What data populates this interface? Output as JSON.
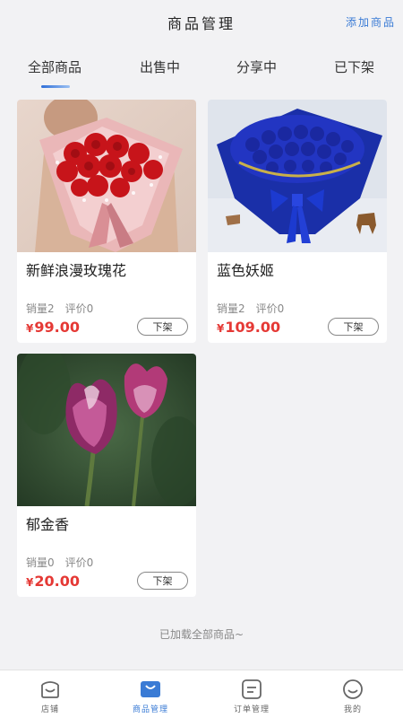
{
  "header": {
    "title": "商品管理",
    "action_label": "添加商品"
  },
  "tabs": [
    {
      "label": "全部商品",
      "active": true
    },
    {
      "label": "出售中",
      "active": false
    },
    {
      "label": "分享中",
      "active": false
    },
    {
      "label": "已下架",
      "active": false
    }
  ],
  "products": [
    {
      "name": "新鲜浪漫玫瑰花",
      "sales": "销量2",
      "reviews": "评价0",
      "currency": "¥",
      "price": "99.00",
      "action_label": "下架",
      "image": "red-rose-bouquet"
    },
    {
      "name": "蓝色妖姬",
      "sales": "销量2",
      "reviews": "评价0",
      "currency": "¥",
      "price": "109.00",
      "action_label": "下架",
      "image": "blue-rose-bouquet"
    },
    {
      "name": "郁金香",
      "sales": "销量0",
      "reviews": "评价0",
      "currency": "¥",
      "price": "20.00",
      "action_label": "下架",
      "image": "purple-tulips"
    }
  ],
  "footer_note": "已加载全部商品~",
  "bottom_nav": [
    {
      "label": "店铺",
      "icon": "shop-icon",
      "active": false
    },
    {
      "label": "商品管理",
      "icon": "bag-icon",
      "active": true
    },
    {
      "label": "订单管理",
      "icon": "order-icon",
      "active": false
    },
    {
      "label": "我的",
      "icon": "profile-icon",
      "active": false
    }
  ],
  "colors": {
    "accent": "#3a7bd5",
    "price": "#e53935",
    "background": "#f2f2f4"
  }
}
